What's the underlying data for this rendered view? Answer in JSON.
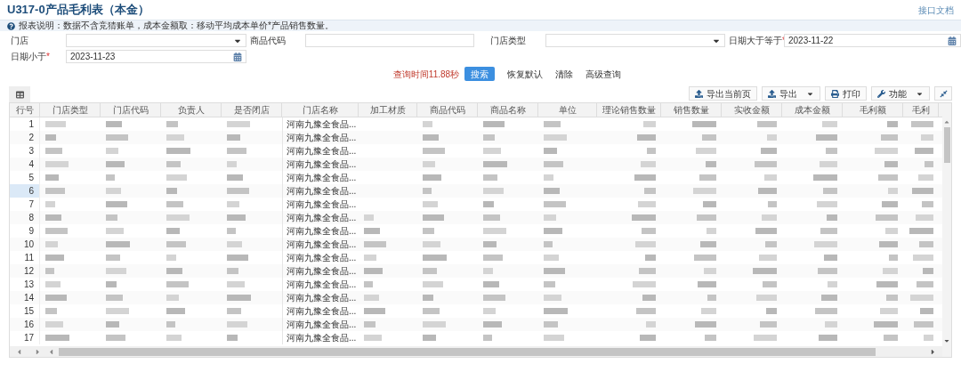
{
  "header": {
    "title": "U317-0产品毛利表（本金）",
    "link": "接口文档"
  },
  "notice": "报表说明：数据不含竞猜账单，成本金额取：移动平均成本单价*产品销售数量。",
  "filters": [
    {
      "label": "门店",
      "kind": "select"
    },
    {
      "label": "商品代码",
      "kind": "text"
    },
    {
      "label": "门店类型",
      "kind": "select"
    },
    {
      "label": "日期大于等于*",
      "kind": "date",
      "value": "2023-11-22"
    },
    {
      "label": "日期小于*",
      "kind": "date",
      "value": "2023-11-23"
    }
  ],
  "query_time": "查询时间11.88秒",
  "actions": [
    {
      "label": "搜索",
      "kind": "primary"
    },
    {
      "label": "恢复默认",
      "kind": "plain"
    },
    {
      "label": "清除",
      "kind": "plain"
    },
    {
      "label": "高级查询",
      "kind": "plain"
    }
  ],
  "toolbar": [
    {
      "label": "导出当前页",
      "kind": "upload",
      "menu": false
    },
    {
      "label": "导出",
      "kind": "upload",
      "menu": true
    },
    {
      "label": "打印",
      "kind": "print",
      "menu": false
    },
    {
      "label": "功能",
      "kind": "wrench",
      "menu": true
    }
  ],
  "table": {
    "columns": [
      "行号",
      "门店类型",
      "门店代码",
      "负责人",
      "是否闭店",
      "门店名称",
      "加工材质",
      "商品代码",
      "商品名称",
      "单位",
      "理论销售数量",
      "销售数量",
      "实收金额",
      "成本金额",
      "毛利额",
      "毛利"
    ],
    "rows": [
      {
        "row_number": "1",
        "store_name": "河南九豫全食品...",
        "selected": false
      },
      {
        "row_number": "2",
        "store_name": "河南九豫全食品...",
        "selected": false
      },
      {
        "row_number": "3",
        "store_name": "河南九豫全食品...",
        "selected": false
      },
      {
        "row_number": "4",
        "store_name": "河南九豫全食品...",
        "selected": false
      },
      {
        "row_number": "5",
        "store_name": "河南九豫全食品...",
        "selected": false
      },
      {
        "row_number": "6",
        "store_name": "河南九豫全食品...",
        "selected": true
      },
      {
        "row_number": "7",
        "store_name": "河南九豫全食品...",
        "selected": false
      },
      {
        "row_number": "8",
        "store_name": "河南九豫全食品...",
        "selected": false
      },
      {
        "row_number": "9",
        "store_name": "河南九豫全食品...",
        "selected": false
      },
      {
        "row_number": "10",
        "store_name": "河南九豫全食品...",
        "selected": false
      },
      {
        "row_number": "11",
        "store_name": "河南九豫全食品...",
        "selected": false
      },
      {
        "row_number": "12",
        "store_name": "河南九豫全食品...",
        "selected": false
      },
      {
        "row_number": "13",
        "store_name": "河南九豫全食品...",
        "selected": false
      },
      {
        "row_number": "14",
        "store_name": "河南九豫全食品...",
        "selected": false
      },
      {
        "row_number": "15",
        "store_name": "河南九豫全食品...",
        "selected": false
      },
      {
        "row_number": "16",
        "store_name": "河南九豫全食品...",
        "selected": false
      },
      {
        "row_number": "17",
        "store_name": "河南九豫全食品...",
        "selected": false
      }
    ]
  }
}
